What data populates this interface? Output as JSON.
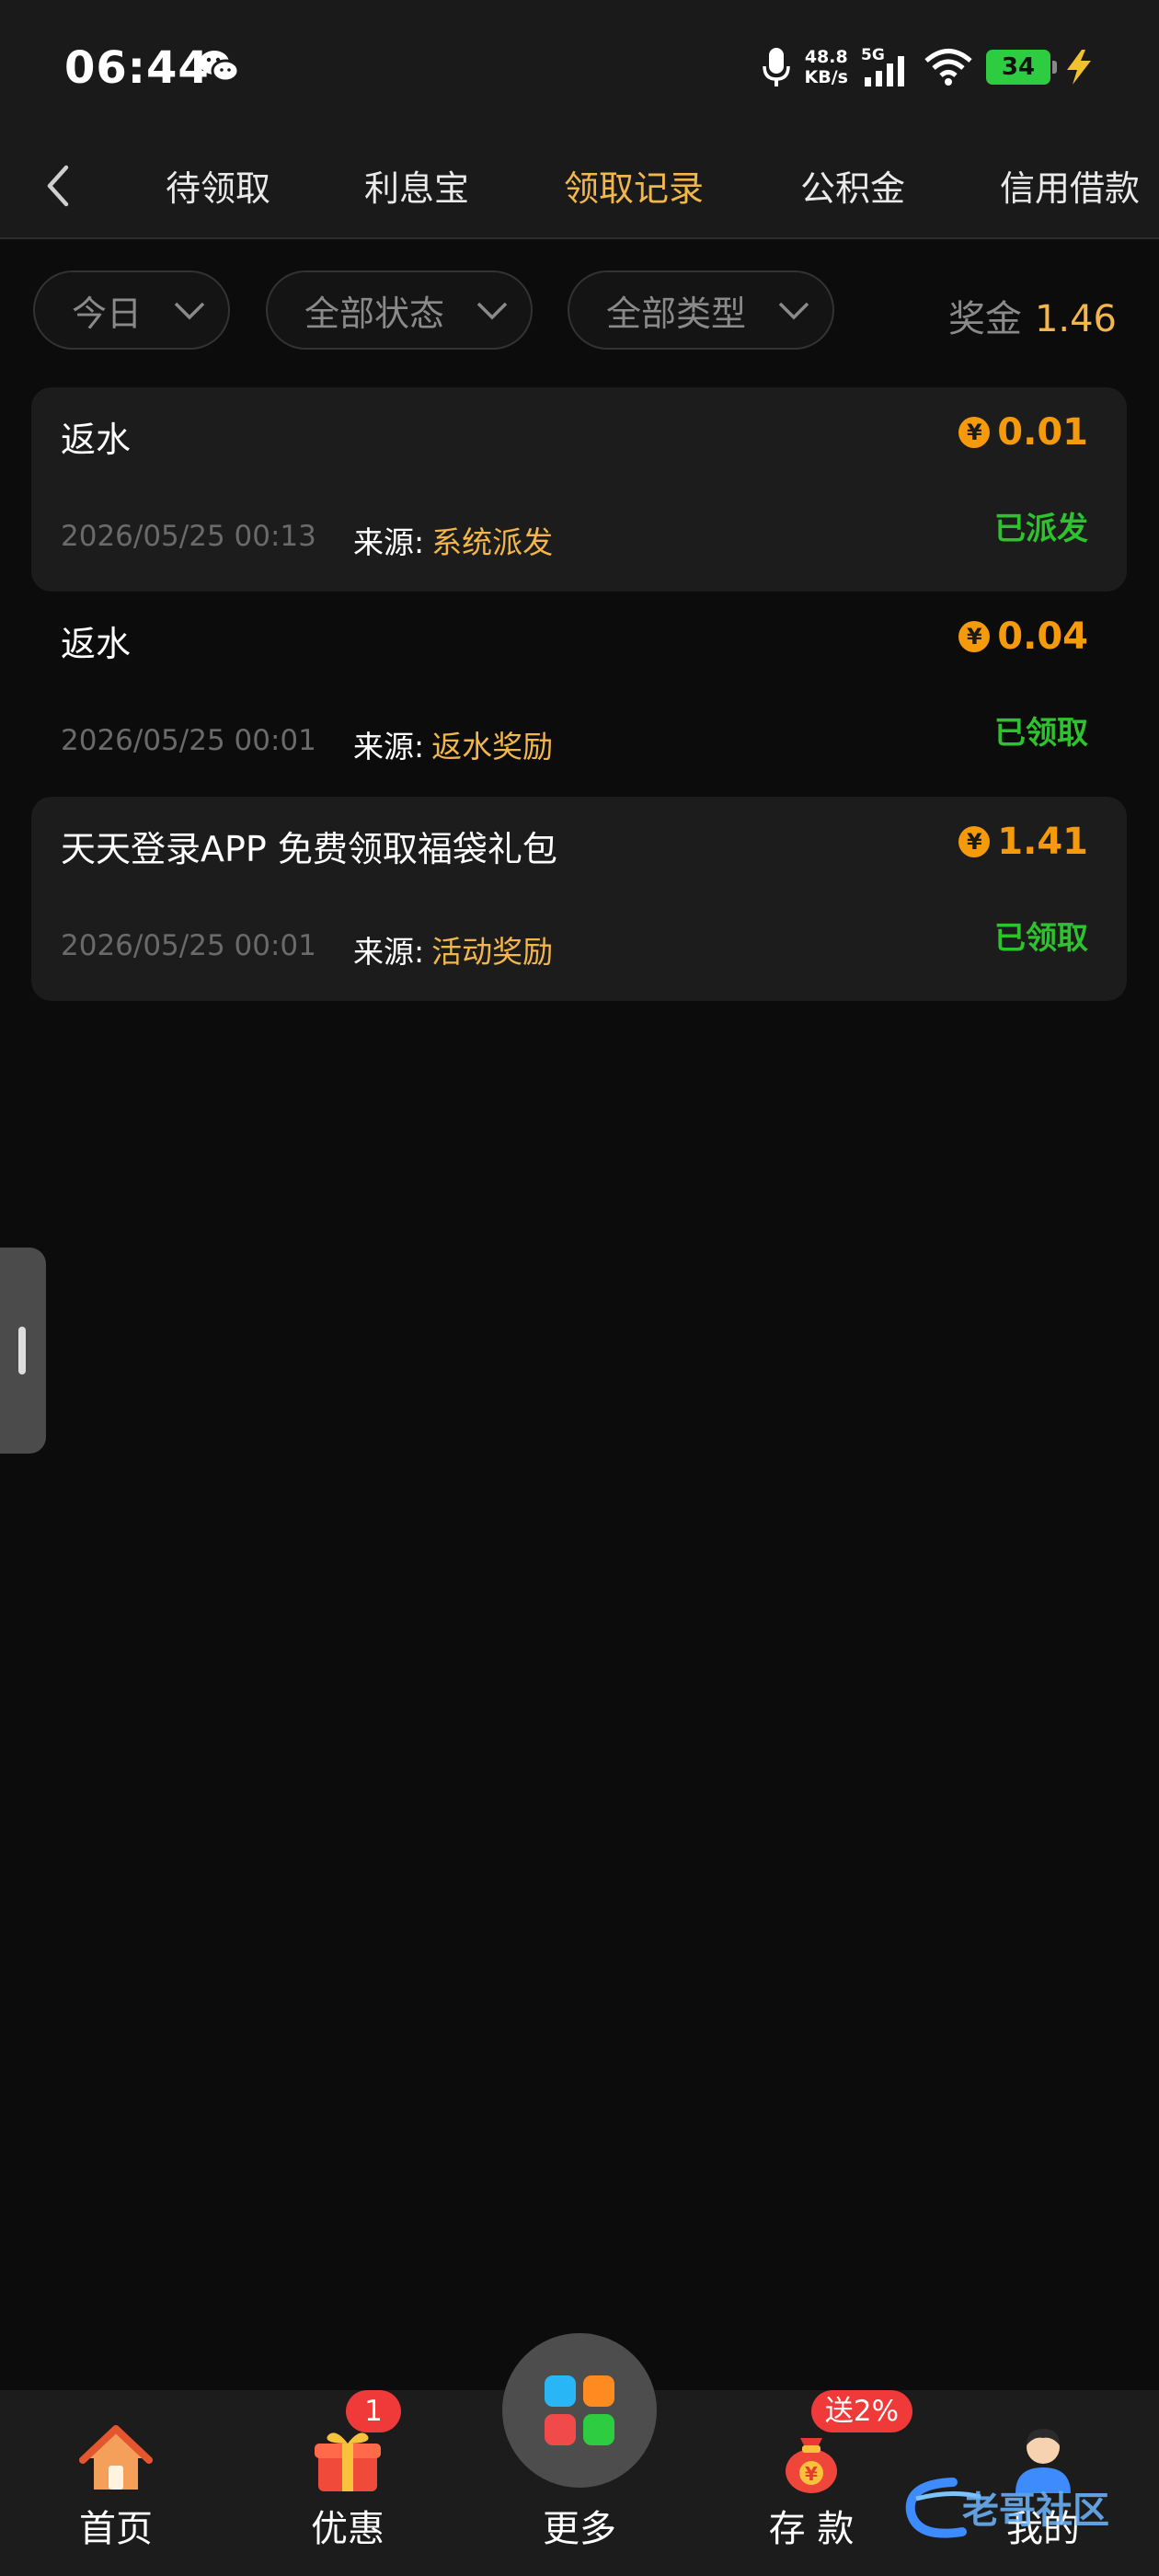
{
  "status_bar": {
    "time": "06:44",
    "net_speed_value": "48.8",
    "net_speed_unit": "KB/s",
    "network_type": "5G",
    "battery": "34"
  },
  "nav": {
    "tabs": [
      {
        "label": "待领取",
        "active": false
      },
      {
        "label": "利息宝",
        "active": false
      },
      {
        "label": "领取记录",
        "active": true
      },
      {
        "label": "公积金",
        "active": false
      },
      {
        "label": "信用借款",
        "active": false
      }
    ]
  },
  "filters": {
    "date": "今日",
    "status": "全部状态",
    "type": "全部类型",
    "bonus_label": "奖金",
    "bonus_value": "1.46"
  },
  "records": [
    {
      "title": "返水",
      "amount": "0.01",
      "currency_icon": "¥",
      "date": "2026/05/25 00:13",
      "source_label": "来源:",
      "source": "系统派发",
      "status": "已派发"
    },
    {
      "title": "返水",
      "amount": "0.04",
      "currency_icon": "¥",
      "date": "2026/05/25 00:01",
      "source_label": "来源:",
      "source": "返水奖励",
      "status": "已领取"
    },
    {
      "title": "天天登录APP 免费领取福袋礼包",
      "amount": "1.41",
      "currency_icon": "¥",
      "date": "2026/05/25 00:01",
      "source_label": "来源:",
      "source": "活动奖励",
      "status": "已领取"
    }
  ],
  "bottom_nav": {
    "items": [
      {
        "label": "首页",
        "icon": "home-icon"
      },
      {
        "label": "优惠",
        "icon": "gift-icon",
        "badge": "1"
      },
      {
        "label": "更多",
        "icon": "apps-grid-icon"
      },
      {
        "label": "存 款",
        "icon": "money-bag-icon",
        "badge": "送2%"
      },
      {
        "label": "我的",
        "icon": "user-icon"
      }
    ]
  },
  "watermark": {
    "text": "老哥社区"
  },
  "colors": {
    "accent": "#f2b64a",
    "amount": "#f59b0b",
    "success": "#2ec22e",
    "badge": "#f03a3a"
  }
}
